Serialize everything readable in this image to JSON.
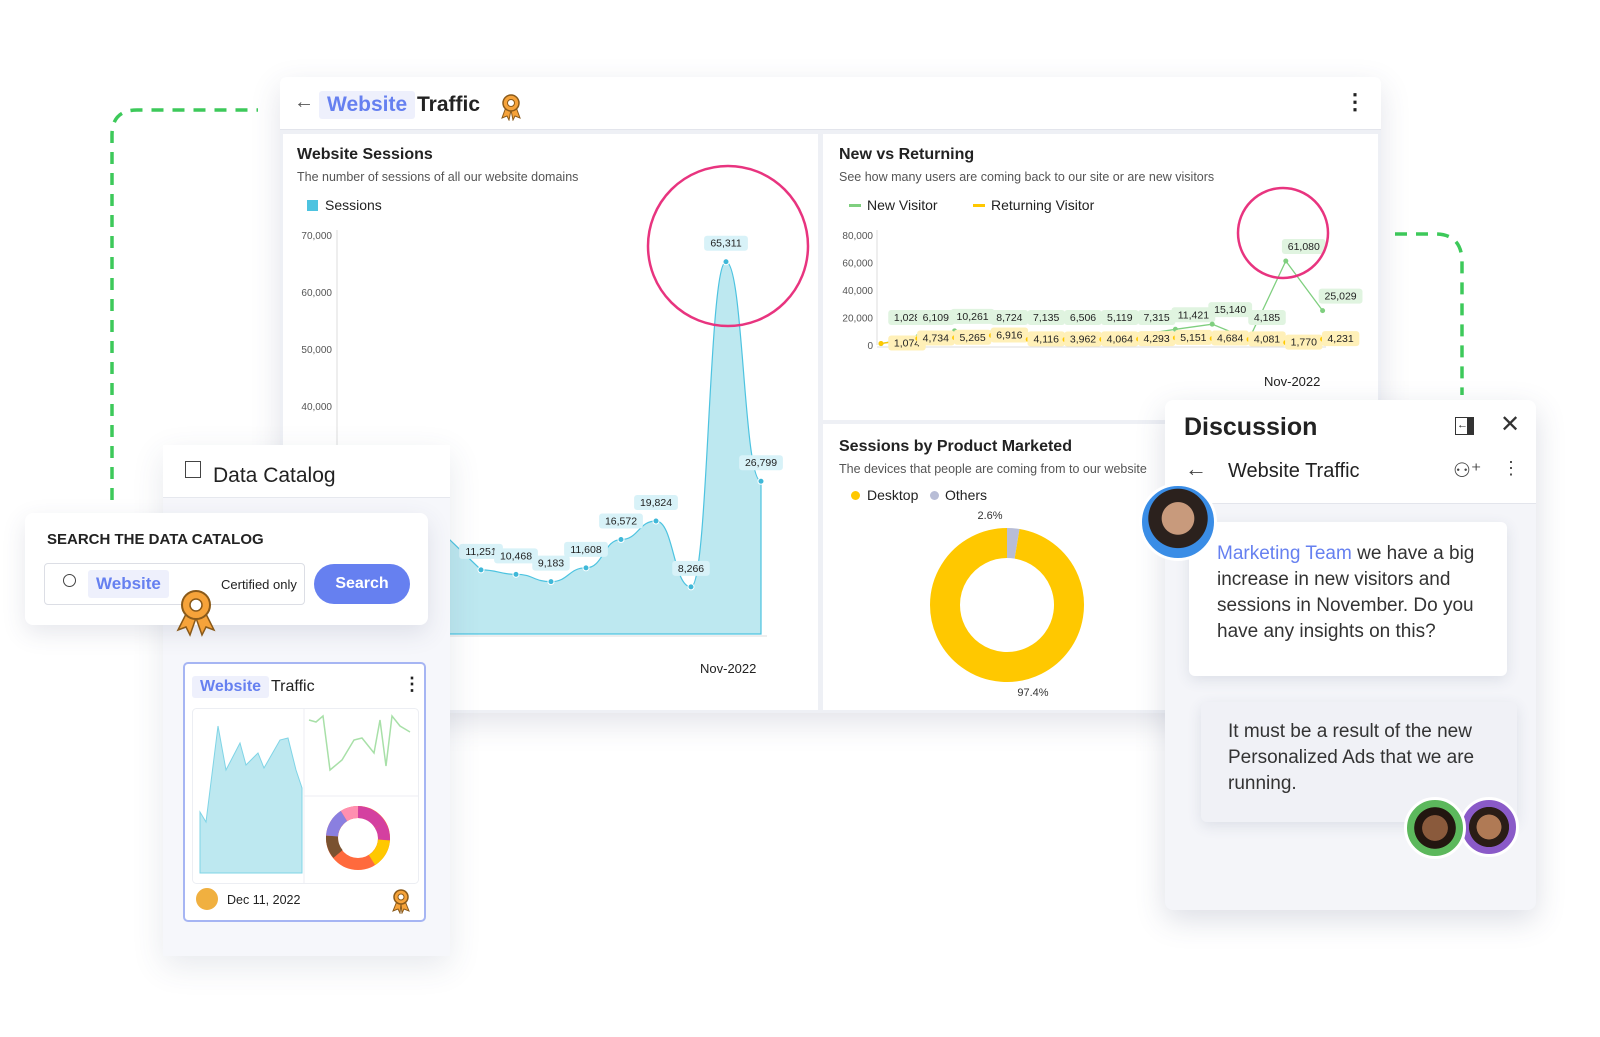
{
  "dashboard": {
    "title_highlight": "Website",
    "title_rest": "Traffic",
    "icon": "certified-badge-icon",
    "sessions": {
      "title": "Website Sessions",
      "subtitle": "The number of sessions of all our website domains",
      "legend": "Sessions",
      "xlabel": "Nov-2022"
    },
    "new_vs_returning": {
      "title": "New vs Returning",
      "subtitle": "See how many users are coming back to our site or are new visitors",
      "legend_new": "New Visitor",
      "legend_returning": "Returning Visitor",
      "xlabel": "Nov-2022"
    },
    "product": {
      "title": "Sessions by Product Marketed",
      "subtitle": "The devices that people are coming from to our website",
      "legend_desktop": "Desktop",
      "legend_others": "Others"
    }
  },
  "chart_data": [
    {
      "type": "area",
      "title": "Website Sessions",
      "series": [
        {
          "name": "Sessions",
          "values": [
            11251,
            10468,
            9183,
            11608,
            16572,
            19824,
            8266,
            65311,
            26799
          ]
        }
      ],
      "y_ticks": [
        "40,000",
        "50,000",
        "60,000",
        "70,000"
      ],
      "ylim": [
        0,
        70000
      ],
      "x_label": "Nov-2022",
      "color": "#4dc3e0"
    },
    {
      "type": "line",
      "title": "New vs Returning",
      "series": [
        {
          "name": "New Visitor",
          "values": [
            1028,
            6109,
            10261,
            8724,
            7135,
            6506,
            5119,
            7315,
            11421,
            15140,
            4185,
            61080,
            25029
          ],
          "color": "#7fcf7f"
        },
        {
          "name": "Returning Visitor",
          "values": [
            1074,
            4734,
            5265,
            6916,
            4116,
            3962,
            4064,
            4293,
            5151,
            4684,
            4081,
            1770,
            4231
          ],
          "color": "#ffc800"
        }
      ],
      "y_ticks": [
        "0",
        "20,000",
        "40,000",
        "60,000",
        "80,000"
      ],
      "ylim": [
        0,
        80000
      ],
      "x_label": "Nov-2022"
    },
    {
      "type": "pie",
      "title": "Sessions by Product Marketed",
      "slices": [
        {
          "name": "Desktop",
          "value": 97.4,
          "label": "97.4%",
          "color": "#ffc800"
        },
        {
          "name": "Others",
          "value": 2.6,
          "label": "2.6%",
          "color": "#b8bdd6"
        }
      ]
    }
  ],
  "catalog": {
    "title": "Data Catalog",
    "search_heading": "SEARCH THE DATA CATALOG",
    "search_value": "Website",
    "certified_label": "Certified only",
    "search_button": "Search",
    "tile": {
      "title_highlight": "Website",
      "title_rest": "Traffic",
      "date": "Dec 11, 2022"
    }
  },
  "discussion": {
    "title": "Discussion",
    "subtitle": "Website Traffic",
    "messages": [
      {
        "mention": "Marketing Team",
        "text": " we have a big increase in new visitors and sessions in November. Do you have any insights on this?"
      },
      {
        "text": "It must be a result of the new Personalized Ads that we are running."
      }
    ]
  },
  "colors": {
    "accent": "#6680f0",
    "highlight_circle": "#e8347f",
    "connector": "#3dc95a"
  }
}
